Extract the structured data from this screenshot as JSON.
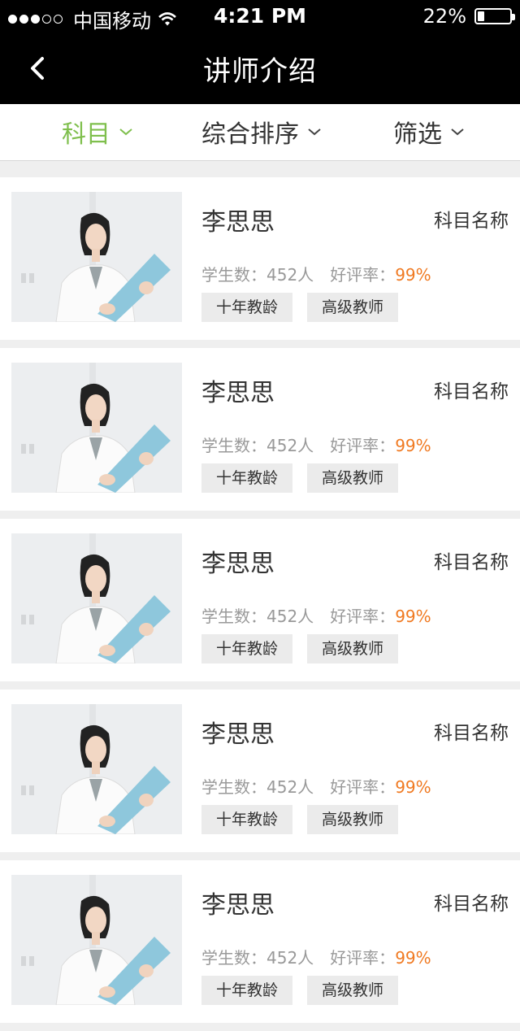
{
  "status_bar": {
    "carrier": "中国移动",
    "time": "4:21 PM",
    "battery": "22%",
    "battery_level": 0.22,
    "signal_bars": 3
  },
  "nav": {
    "title": "讲师介绍"
  },
  "filters": [
    {
      "label": "科目",
      "active": true
    },
    {
      "label": "综合排序",
      "active": false
    },
    {
      "label": "筛选",
      "active": false
    }
  ],
  "teachers": [
    {
      "name": "李思思",
      "subject": "科目名称",
      "students_label": "学生数：",
      "students": "452人",
      "rating_label": "好评率：",
      "rating": "99%",
      "tags": [
        "十年教龄",
        "高级教师"
      ]
    },
    {
      "name": "李思思",
      "subject": "科目名称",
      "students_label": "学生数：",
      "students": "452人",
      "rating_label": "好评率：",
      "rating": "99%",
      "tags": [
        "十年教龄",
        "高级教师"
      ]
    },
    {
      "name": "李思思",
      "subject": "科目名称",
      "students_label": "学生数：",
      "students": "452人",
      "rating_label": "好评率：",
      "rating": "99%",
      "tags": [
        "十年教龄",
        "高级教师"
      ]
    },
    {
      "name": "李思思",
      "subject": "科目名称",
      "students_label": "学生数：",
      "students": "452人",
      "rating_label": "好评率：",
      "rating": "99%",
      "tags": [
        "十年教龄",
        "高级教师"
      ]
    },
    {
      "name": "李思思",
      "subject": "科目名称",
      "students_label": "学生数：",
      "students": "452人",
      "rating_label": "好评率：",
      "rating": "99%",
      "tags": [
        "十年教龄",
        "高级教师"
      ]
    }
  ],
  "colors": {
    "accent": "#7fbf4d",
    "rating": "#f07a22",
    "header": "#000000"
  }
}
